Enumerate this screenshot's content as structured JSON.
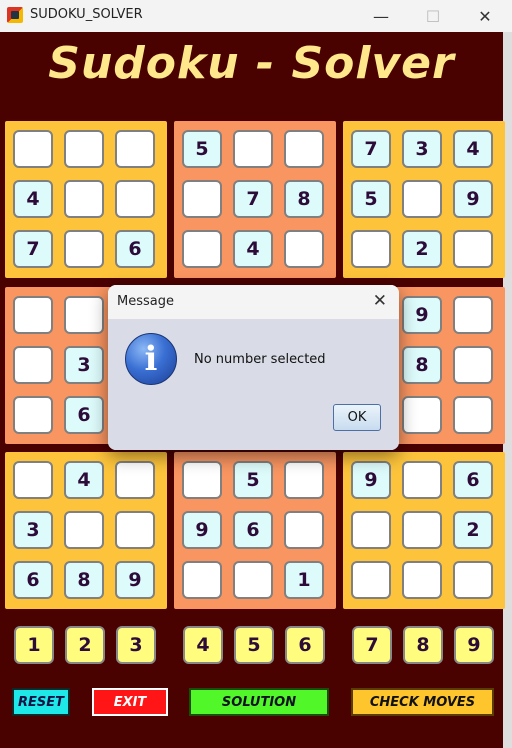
{
  "window": {
    "title": "SUDOKU_SOLVER",
    "minimize": "—",
    "maximize": "☐",
    "close": "✕"
  },
  "app_title": "Sudoku - Solver",
  "board": [
    [
      "",
      "",
      "",
      "5",
      "",
      "",
      "7",
      "3",
      "4"
    ],
    [
      "4",
      "",
      "",
      "",
      "7",
      "8",
      "5",
      "",
      "9"
    ],
    [
      "7",
      "",
      "6",
      "",
      "4",
      "",
      "",
      "2",
      ""
    ],
    [
      "",
      "",
      "",
      "",
      "",
      "",
      "",
      "9",
      ""
    ],
    [
      "",
      "3",
      "",
      "",
      "",
      "",
      "",
      "8",
      ""
    ],
    [
      "",
      "6",
      "",
      "",
      "",
      "",
      "",
      "",
      ""
    ],
    [
      "",
      "4",
      "",
      "",
      "5",
      "",
      "9",
      "",
      "6"
    ],
    [
      "3",
      "",
      "",
      "9",
      "6",
      "",
      "",
      "",
      "2"
    ],
    [
      "6",
      "8",
      "9",
      "",
      "",
      "1",
      "",
      "",
      ""
    ]
  ],
  "box_colors": {
    "yellow": "#fdc43b",
    "orange": "#f99561"
  },
  "number_buttons": [
    "1",
    "2",
    "3",
    "4",
    "5",
    "6",
    "7",
    "8",
    "9"
  ],
  "controls": {
    "reset": "RESET",
    "exit": "EXIT",
    "solution": "SOLUTION",
    "check_moves": "CHECK MOVES"
  },
  "dialog": {
    "title": "Message",
    "message": "No number selected",
    "ok": "OK",
    "icon_letter": "i",
    "close": "✕"
  }
}
